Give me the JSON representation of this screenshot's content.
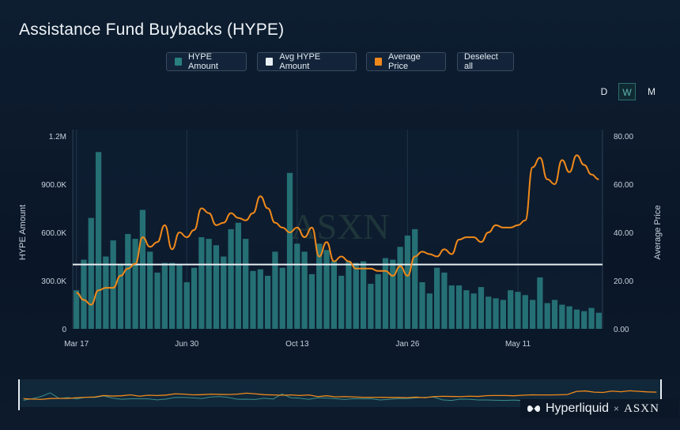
{
  "title": "Assistance Fund Buybacks (HYPE)",
  "legend": [
    {
      "label": "HYPE Amount",
      "color": "#2a7f80"
    },
    {
      "label": "Avg HYPE Amount",
      "color": "#e8eef2"
    },
    {
      "label": "Average Price",
      "color": "#f0891a"
    },
    {
      "label": "Deselect all"
    }
  ],
  "periods": {
    "d": "D",
    "w": "W",
    "m": "M",
    "active": "W"
  },
  "watermark": "ASXN",
  "brand": {
    "hyperliquid": "Hyperliquid",
    "sep": "×",
    "asxn": "ASXN"
  },
  "chart_data": {
    "type": "bar",
    "title": "Assistance Fund Buybacks (HYPE)",
    "xlabel": "",
    "ylabel": "HYPE Amount",
    "y2label": "Average Price",
    "ylim": [
      0,
      1200000
    ],
    "y2lim": [
      0,
      80
    ],
    "yticks": [
      "0",
      "300.0K",
      "600.0K",
      "900.0K",
      "1.2M"
    ],
    "y2ticks": [
      "0.00",
      "20.00",
      "40.00",
      "60.00",
      "80.00"
    ],
    "xticks": [
      {
        "label": "Mar 17",
        "index": 0
      },
      {
        "label": "Jun 30",
        "index": 15
      },
      {
        "label": "Oct 13",
        "index": 30
      },
      {
        "label": "Jan 26",
        "index": 45
      },
      {
        "label": "May 11",
        "index": 60
      }
    ],
    "series": [
      {
        "name": "HYPE Amount",
        "type": "bar",
        "color": "#2a7f80",
        "values": [
          240000,
          430000,
          690000,
          1100000,
          450000,
          550000,
          400000,
          590000,
          560000,
          740000,
          480000,
          350000,
          410000,
          410000,
          400000,
          290000,
          380000,
          570000,
          560000,
          520000,
          450000,
          620000,
          660000,
          560000,
          360000,
          370000,
          330000,
          480000,
          380000,
          970000,
          530000,
          480000,
          340000,
          530000,
          490000,
          420000,
          330000,
          420000,
          410000,
          420000,
          280000,
          340000,
          440000,
          430000,
          510000,
          580000,
          620000,
          290000,
          220000,
          380000,
          350000,
          270000,
          270000,
          240000,
          220000,
          260000,
          200000,
          190000,
          180000,
          240000,
          230000,
          210000,
          180000,
          320000,
          160000,
          180000,
          150000,
          140000,
          120000,
          110000,
          130000,
          100000
        ]
      },
      {
        "name": "Avg HYPE Amount",
        "type": "line",
        "color": "#e8eef2",
        "values": [
          400000
        ]
      },
      {
        "name": "Average Price",
        "type": "line",
        "color": "#f0891a",
        "values": [
          15,
          12,
          10,
          16,
          17,
          17,
          22,
          25,
          27,
          38,
          34,
          36,
          43,
          33,
          40,
          38,
          41,
          50,
          48,
          43,
          44,
          48,
          46,
          45,
          48,
          55,
          50,
          44,
          42,
          40,
          42,
          38,
          42,
          30,
          36,
          28,
          30,
          28,
          25,
          25,
          25,
          24,
          24,
          22,
          26,
          22,
          30,
          32,
          31,
          30,
          33,
          31,
          37,
          38,
          38,
          36,
          40,
          43,
          42,
          42,
          43,
          45,
          67,
          71,
          62,
          60,
          70,
          65,
          72,
          68,
          64,
          62
        ]
      }
    ],
    "grid": "vertical"
  }
}
